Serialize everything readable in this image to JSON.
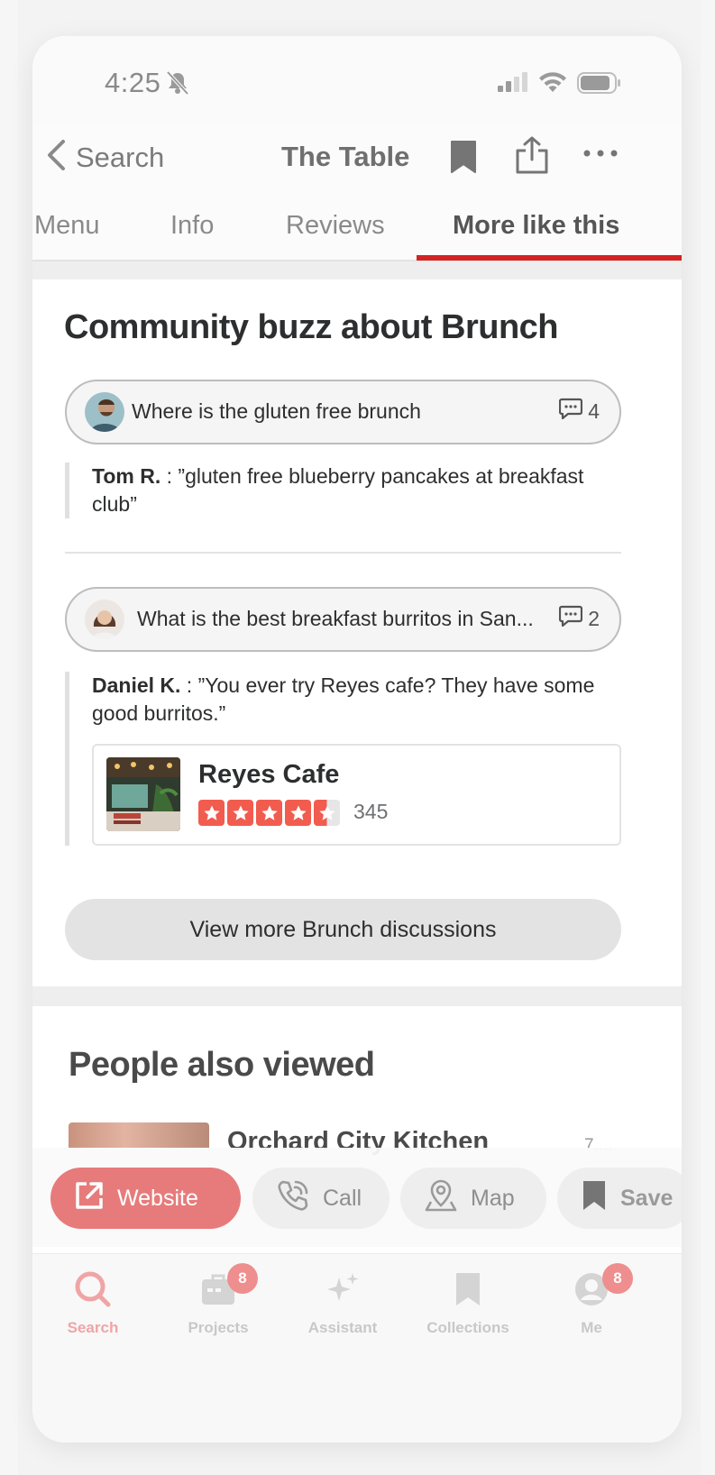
{
  "status_bar": {
    "time": "4:25"
  },
  "nav": {
    "back_label": "Search",
    "title": "The Table"
  },
  "tabs": [
    {
      "label": "Menu"
    },
    {
      "label": "Info"
    },
    {
      "label": "Reviews"
    },
    {
      "label": "More like this"
    }
  ],
  "community": {
    "heading": "Community buzz about Brunch",
    "threads": [
      {
        "question": "Where is the gluten free brunch",
        "count": "4",
        "author": "Tom R.",
        "quote": " : ”gluten free blueberry pancakes at breakfast club”"
      },
      {
        "question": "What is the best breakfast burritos in San...",
        "count": "2",
        "author": "Daniel K.",
        "quote": " : ”You ever try Reyes cafe? They have some good burritos.”"
      }
    ],
    "business": {
      "name": "Reyes Cafe",
      "rating": 4.5,
      "review_count": "345"
    },
    "view_more_label": "View more Brunch discussions"
  },
  "people_also_viewed": {
    "heading": "People also viewed",
    "first_item": {
      "name": "Orchard City Kitchen",
      "distance": "7...."
    }
  },
  "action_bar": {
    "website_label": "Website",
    "call_label": "Call",
    "map_label": "Map",
    "save_label": "Save"
  },
  "tab_bar": {
    "items": [
      {
        "label": "Search",
        "badge": ""
      },
      {
        "label": "Projects",
        "badge": "8"
      },
      {
        "label": "Assistant",
        "badge": ""
      },
      {
        "label": "Collections",
        "badge": ""
      },
      {
        "label": "Me",
        "badge": "8"
      }
    ]
  },
  "colors": {
    "brand_red": "#d32323",
    "star_red": "#f15c4f"
  }
}
